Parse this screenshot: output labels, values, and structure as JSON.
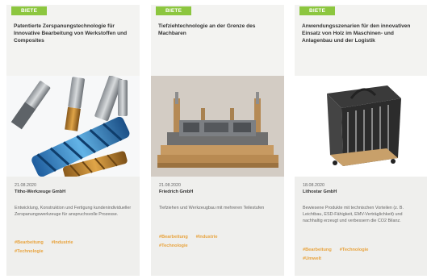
{
  "cards": [
    {
      "badge": "BIETE",
      "title": "Patentierte Zerspanungstechnologie für Innovative Bearbeitung von Werkstoffen und Composites",
      "image_icon": "drill-tools-image",
      "date": "21.08.2020",
      "company": "Titho-Werkzeuge GmbH",
      "description": "Entwicklung, Konstruktion und Fertigung kundenindividueller Zerspanungswerkzeuge für anspruchsvolle Prozesse.",
      "tags": [
        "#Bearbeitung",
        "#Industrie",
        "#Technologie"
      ]
    },
    {
      "badge": "BIETE",
      "title": "Tiefziehtechnologie an der Grenze des Machbaren",
      "image_icon": "deep-drawing-tool-image",
      "date": "21.08.2020",
      "company": "Friedrich GmbH",
      "description": "Tiefziehen und Werkzeugbau mit mehreren Teilestufen",
      "tags": [
        "#Bearbeitung",
        "#Industrie",
        "#Technologie"
      ]
    },
    {
      "badge": "BIETE",
      "title": "Anwendungsszenarien für den innovativen Einsatz von Holz im Maschinen- und Anlagenbau und der Logistik",
      "image_icon": "wooden-rack-image",
      "date": "18.08.2020",
      "company": "Lithostar GmbH",
      "description": "Bewiesene Produkte mit technischen Vorteilen (z. B. Leichtbau, ESD-Fähigkeit, EMV-Verträglichkeit) und nachhaltig erzeugt und verbessern die CO2 Bilanz.",
      "tags": [
        "#Bearbeitung",
        "#Technologie",
        "#Umwelt"
      ]
    }
  ],
  "colors": {
    "badge": "#8cc63f",
    "tag": "#e8a33d",
    "card_bg": "#f3f3f1"
  }
}
